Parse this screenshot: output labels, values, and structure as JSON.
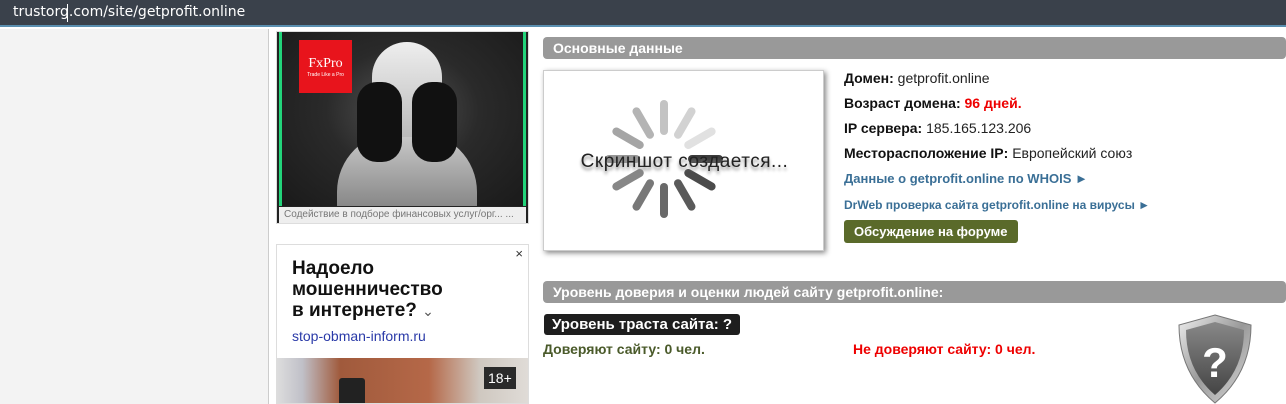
{
  "address_bar": {
    "url": "trustorg.com/site/getprofit.online"
  },
  "ads": {
    "fxpro": {
      "logo": "FxPro",
      "tagline": "Trade Like a Pro",
      "caption": "Содействие в подборе финансовых услуг/орг... ..."
    },
    "yandex": {
      "title_lines": [
        "Надоело",
        "мошенничество",
        "в интернете?"
      ],
      "link": "stop-obman-inform.ru",
      "age": "18+",
      "close": "×",
      "chevron": "⌄"
    }
  },
  "basic": {
    "header": "Основные данные",
    "screenshot_text": "Скриншот создается...",
    "domain_label": "Домен:",
    "domain": "getprofit.online",
    "age_label": "Возраст домена:",
    "age": "96 дней.",
    "ip_label": "IP сервера:",
    "ip": "185.165.123.206",
    "location_label": "Месторасположение IP:",
    "location": "Европейский союз",
    "whois_link": "Данные о getprofit.online по WHOIS ►",
    "drweb_link": "DrWeb проверка сайта getprofit.online на вирусы ►",
    "forum_button": "Обсуждение на форуме"
  },
  "trust": {
    "header": "Уровень доверия и оценки людей сайту getprofit.online:",
    "level": "Уровень траста сайта: ?",
    "trust_count": "Доверяют сайту: 0 чел.",
    "distrust_count": "Не доверяют сайту: 0 чел.",
    "shield_symbol": "?"
  }
}
